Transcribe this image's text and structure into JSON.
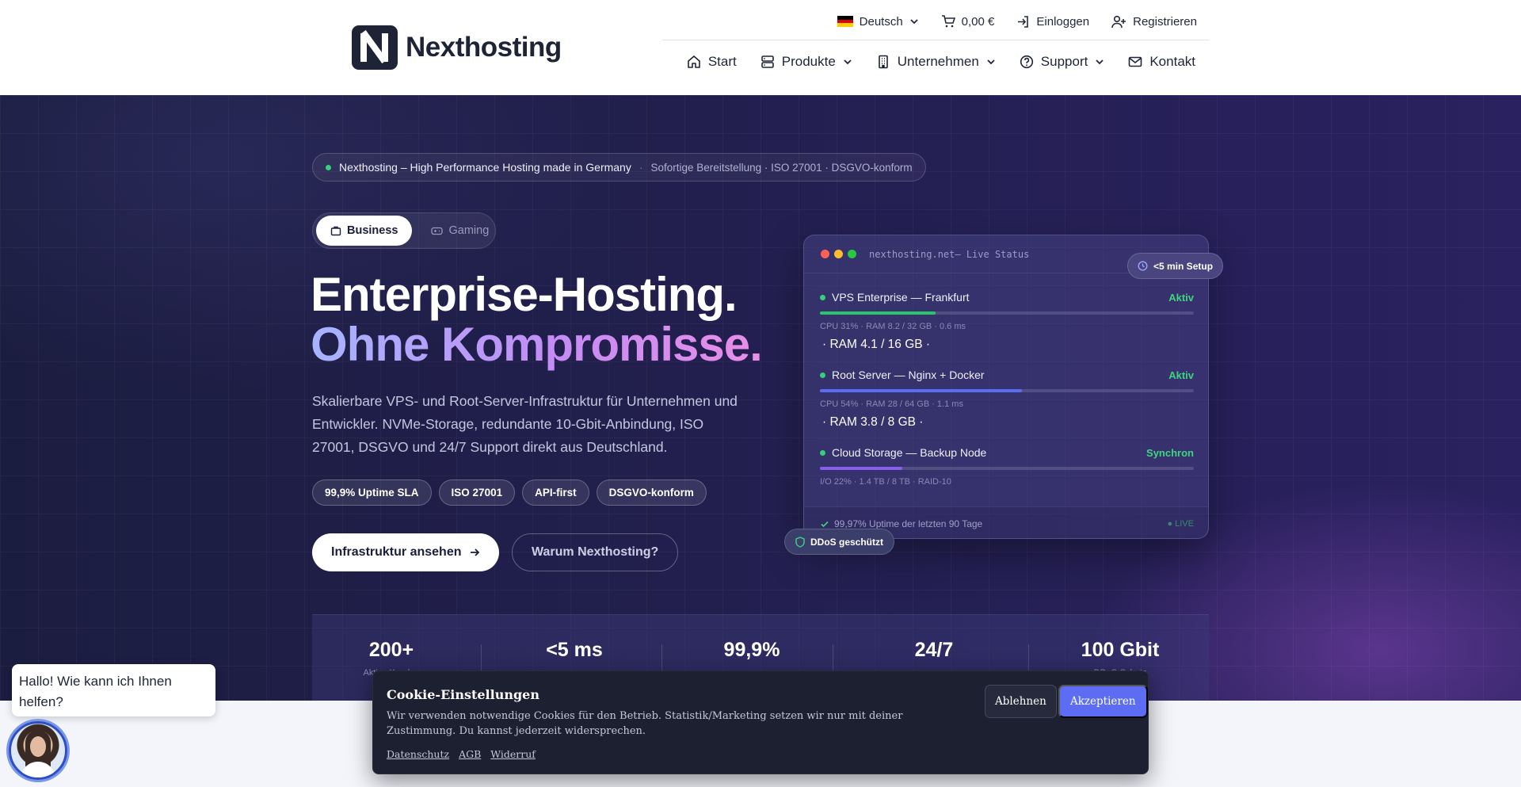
{
  "brand": {
    "name": "Nexthosting"
  },
  "topbar": {
    "language": "Deutsch",
    "cart": "0,00 €",
    "login": "Einloggen",
    "register": "Registrieren"
  },
  "nav": [
    {
      "label": "Start",
      "icon": "home-icon"
    },
    {
      "label": "Produkte",
      "icon": "server-icon",
      "dropdown": true
    },
    {
      "label": "Unternehmen",
      "icon": "building-icon",
      "dropdown": true
    },
    {
      "label": "Support",
      "icon": "help-circle-icon",
      "dropdown": true
    },
    {
      "label": "Kontakt",
      "icon": "mail-icon"
    }
  ],
  "hero": {
    "announcement": "Nexthosting – High Performance Hosting made in Germany",
    "announcement_sub": "Sofortige Bereitstellung · ISO 27001 · DSGVO-konform",
    "toggle": {
      "business": "Business",
      "gaming": "Gaming",
      "active": "business"
    },
    "title_line1": "Enterprise-Hosting.",
    "title_line2": "Ohne Kompromisse.",
    "lead": "Skalierbare VPS- und Root-Server-Infrastruktur für Unternehmen und Entwickler. NVMe-Storage, redundante 10-Gbit-Anbindung, ISO 27001, DSGVO und 24/7 Support direkt aus Deutschland.",
    "badges": [
      "99,9% Uptime SLA",
      "ISO 27001",
      "API-first",
      "DSGVO-konform"
    ],
    "cta_primary": "Infrastruktur ansehen",
    "cta_secondary": "Warum Nexthosting?"
  },
  "status_card": {
    "title": "nexthosting.net— Live Status",
    "setup_badge": "<5 min Setup",
    "ddos_badge": "DDoS geschützt",
    "servers": [
      {
        "name": "VPS Enterprise — Frankfurt",
        "state": "Aktiv",
        "load": 0.31,
        "bar_color": "#2bc46a",
        "meta": "CPU 31% · RAM 8.2 / 32 GB · 0.6 ms",
        "ram": "· RAM 4.1 / 16 GB ·"
      },
      {
        "name": "Root Server — Nginx + Docker",
        "state": "Aktiv",
        "load": 0.54,
        "bar_color": "#5b6cf0",
        "meta": "CPU 54% · RAM 28 / 64 GB · 1.1 ms",
        "ram": "· RAM 3.8 / 8 GB ·"
      },
      {
        "name": "Cloud Storage — Backup Node",
        "state": "Synchron",
        "load": 0.22,
        "bar_color": "#8b5cf0",
        "meta": "I/O 22% · 1.4 TB / 8 TB · RAID-10",
        "ram": ""
      }
    ],
    "uptime": "99,97% Uptime der letzten 90 Tage",
    "live": "● LIVE"
  },
  "stats": [
    {
      "value": "200+",
      "label": "Aktive Kunden"
    },
    {
      "value": "<5 ms",
      "label": ""
    },
    {
      "value": "99,9%",
      "label": ""
    },
    {
      "value": "24/7",
      "label": ""
    },
    {
      "value": "100 Gbit",
      "label": "DDoS-Schutz"
    }
  ],
  "cookie": {
    "title": "Cookie-Einstellungen",
    "body": "Wir verwenden notwendige Cookies für den Betrieb. Statistik/Marketing setzen wir nur mit deiner Zustimmung. Du kannst jederzeit widersprechen.",
    "links": [
      "Datenschutz",
      "AGB",
      "Widerruf"
    ],
    "decline": "Ablehnen",
    "accept": "Akzeptieren"
  },
  "chat": {
    "greeting": "Hallo! Wie kann ich Ihnen helfen?"
  },
  "colors": {
    "accent": "#5c6df3",
    "success": "#3fd57f",
    "dark": "#1e2436"
  }
}
